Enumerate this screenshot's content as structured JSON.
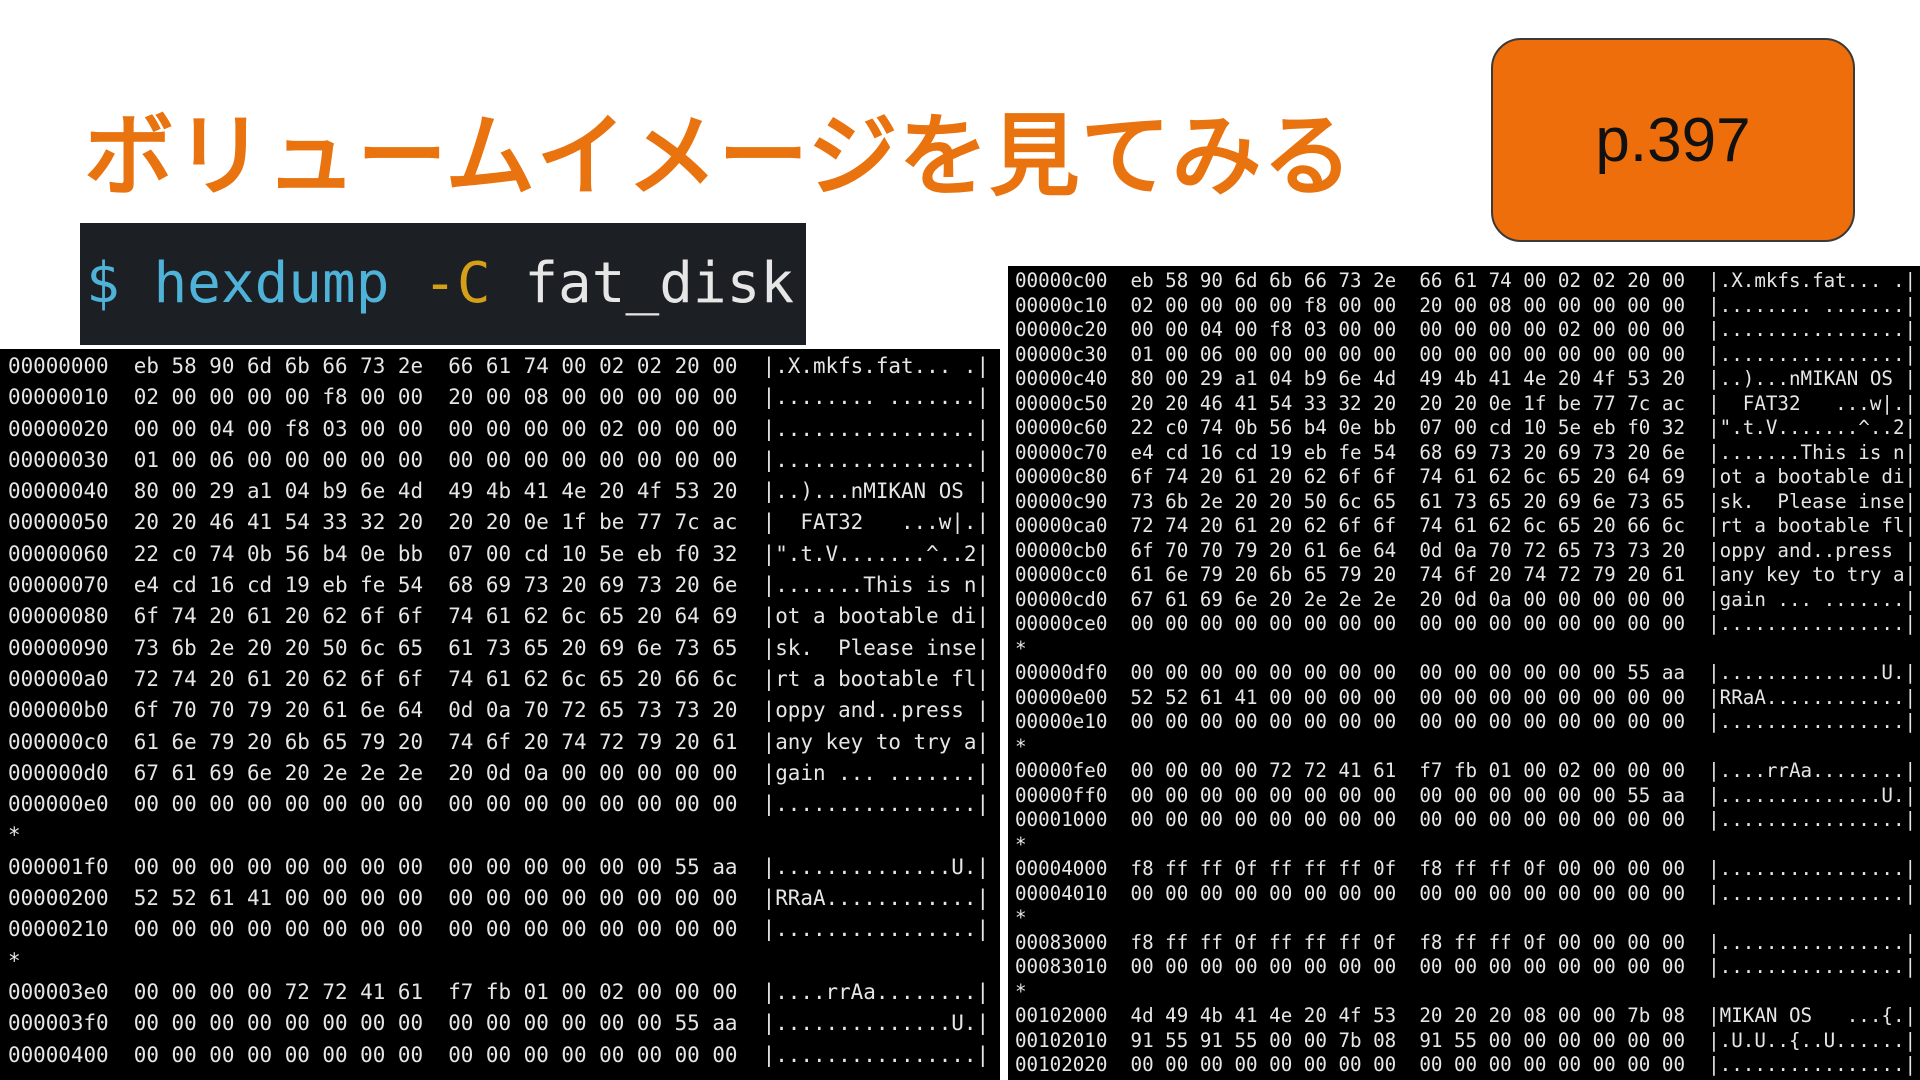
{
  "slide": {
    "title": "ボリュームイメージを見てみる",
    "page_label": "p.397",
    "title_color": "#e8730f",
    "badge_color": "#ee6e0c"
  },
  "command": {
    "prompt": "$",
    "program": "hexdump",
    "flag": "-C",
    "argument": "fat_disk",
    "colors": {
      "prompt": "#4fb3d9",
      "program": "#4fb3d9",
      "flag": "#d4a017",
      "argument": "#e6e6e6"
    }
  },
  "left_terminal": {
    "lines": [
      "00000000  eb 58 90 6d 6b 66 73 2e  66 61 74 00 02 02 20 00  |.X.mkfs.fat... .|",
      "00000010  02 00 00 00 00 f8 00 00  20 00 08 00 00 00 00 00  |........ .......|",
      "00000020  00 00 04 00 f8 03 00 00  00 00 00 00 02 00 00 00  |................|",
      "00000030  01 00 06 00 00 00 00 00  00 00 00 00 00 00 00 00  |................|",
      "00000040  80 00 29 a1 04 b9 6e 4d  49 4b 41 4e 20 4f 53 20  |..)...nMIKAN OS |",
      "00000050  20 20 46 41 54 33 32 20  20 20 0e 1f be 77 7c ac  |  FAT32   ...w|.|",
      "00000060  22 c0 74 0b 56 b4 0e bb  07 00 cd 10 5e eb f0 32  |\".t.V.......^..2|",
      "00000070  e4 cd 16 cd 19 eb fe 54  68 69 73 20 69 73 20 6e  |.......This is n|",
      "00000080  6f 74 20 61 20 62 6f 6f  74 61 62 6c 65 20 64 69  |ot a bootable di|",
      "00000090  73 6b 2e 20 20 50 6c 65  61 73 65 20 69 6e 73 65  |sk.  Please inse|",
      "000000a0  72 74 20 61 20 62 6f 6f  74 61 62 6c 65 20 66 6c  |rt a bootable fl|",
      "000000b0  6f 70 70 79 20 61 6e 64  0d 0a 70 72 65 73 73 20  |oppy and..press |",
      "000000c0  61 6e 79 20 6b 65 79 20  74 6f 20 74 72 79 20 61  |any key to try a|",
      "000000d0  67 61 69 6e 20 2e 2e 2e  20 0d 0a 00 00 00 00 00  |gain ... .......|",
      "000000e0  00 00 00 00 00 00 00 00  00 00 00 00 00 00 00 00  |................|",
      "*",
      "000001f0  00 00 00 00 00 00 00 00  00 00 00 00 00 00 55 aa  |..............U.|",
      "00000200  52 52 61 41 00 00 00 00  00 00 00 00 00 00 00 00  |RRaA............|",
      "00000210  00 00 00 00 00 00 00 00  00 00 00 00 00 00 00 00  |................|",
      "*",
      "000003e0  00 00 00 00 72 72 41 61  f7 fb 01 00 02 00 00 00  |....rrAa........|",
      "000003f0  00 00 00 00 00 00 00 00  00 00 00 00 00 00 55 aa  |..............U.|",
      "00000400  00 00 00 00 00 00 00 00  00 00 00 00 00 00 00 00  |................|"
    ]
  },
  "right_terminal": {
    "lines": [
      "00000c00  eb 58 90 6d 6b 66 73 2e  66 61 74 00 02 02 20 00  |.X.mkfs.fat... .|",
      "00000c10  02 00 00 00 00 f8 00 00  20 00 08 00 00 00 00 00  |........ .......|",
      "00000c20  00 00 04 00 f8 03 00 00  00 00 00 00 02 00 00 00  |................|",
      "00000c30  01 00 06 00 00 00 00 00  00 00 00 00 00 00 00 00  |................|",
      "00000c40  80 00 29 a1 04 b9 6e 4d  49 4b 41 4e 20 4f 53 20  |..)...nMIKAN OS |",
      "00000c50  20 20 46 41 54 33 32 20  20 20 0e 1f be 77 7c ac  |  FAT32   ...w|.|",
      "00000c60  22 c0 74 0b 56 b4 0e bb  07 00 cd 10 5e eb f0 32  |\".t.V.......^..2|",
      "00000c70  e4 cd 16 cd 19 eb fe 54  68 69 73 20 69 73 20 6e  |.......This is n|",
      "00000c80  6f 74 20 61 20 62 6f 6f  74 61 62 6c 65 20 64 69  |ot a bootable di|",
      "00000c90  73 6b 2e 20 20 50 6c 65  61 73 65 20 69 6e 73 65  |sk.  Please inse|",
      "00000ca0  72 74 20 61 20 62 6f 6f  74 61 62 6c 65 20 66 6c  |rt a bootable fl|",
      "00000cb0  6f 70 70 79 20 61 6e 64  0d 0a 70 72 65 73 73 20  |oppy and..press |",
      "00000cc0  61 6e 79 20 6b 65 79 20  74 6f 20 74 72 79 20 61  |any key to try a|",
      "00000cd0  67 61 69 6e 20 2e 2e 2e  20 0d 0a 00 00 00 00 00  |gain ... .......|",
      "00000ce0  00 00 00 00 00 00 00 00  00 00 00 00 00 00 00 00  |................|",
      "*",
      "00000df0  00 00 00 00 00 00 00 00  00 00 00 00 00 00 55 aa  |..............U.|",
      "00000e00  52 52 61 41 00 00 00 00  00 00 00 00 00 00 00 00  |RRaA............|",
      "00000e10  00 00 00 00 00 00 00 00  00 00 00 00 00 00 00 00  |................|",
      "*",
      "00000fe0  00 00 00 00 72 72 41 61  f7 fb 01 00 02 00 00 00  |....rrAa........|",
      "00000ff0  00 00 00 00 00 00 00 00  00 00 00 00 00 00 55 aa  |..............U.|",
      "00001000  00 00 00 00 00 00 00 00  00 00 00 00 00 00 00 00  |................|",
      "*",
      "00004000  f8 ff ff 0f ff ff ff 0f  f8 ff ff 0f 00 00 00 00  |................|",
      "00004010  00 00 00 00 00 00 00 00  00 00 00 00 00 00 00 00  |................|",
      "*",
      "00083000  f8 ff ff 0f ff ff ff 0f  f8 ff ff 0f 00 00 00 00  |................|",
      "00083010  00 00 00 00 00 00 00 00  00 00 00 00 00 00 00 00  |................|",
      "*",
      "00102000  4d 49 4b 41 4e 20 4f 53  20 20 20 08 00 00 7b 08  |MIKAN OS   ...{.|",
      "00102010  91 55 91 55 00 00 7b 08  91 55 00 00 00 00 00 00  |.U.U..{..U......|",
      "00102020  00 00 00 00 00 00 00 00  00 00 00 00 00 00 00 00  |................|"
    ]
  }
}
